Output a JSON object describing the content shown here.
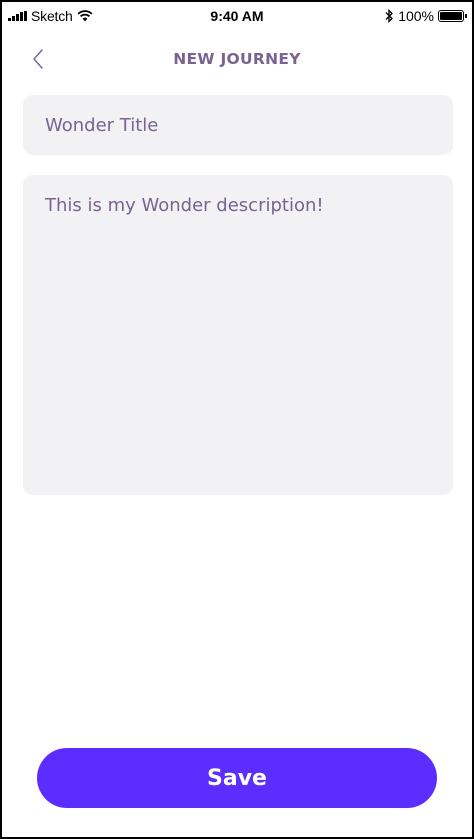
{
  "status_bar": {
    "carrier": "Sketch",
    "time": "9:40 AM",
    "battery": "100%",
    "battery_level": 1.0
  },
  "header": {
    "title": "NEW JOURNEY",
    "back_icon": "chevron-left-icon"
  },
  "form": {
    "title_placeholder": "Wonder Title",
    "description_text": "This is my Wonder description!"
  },
  "actions": {
    "save_label": "Save"
  },
  "colors": {
    "accent": "#5b2eff",
    "title_text": "#7a6291",
    "field_background": "#f2f2f5"
  }
}
